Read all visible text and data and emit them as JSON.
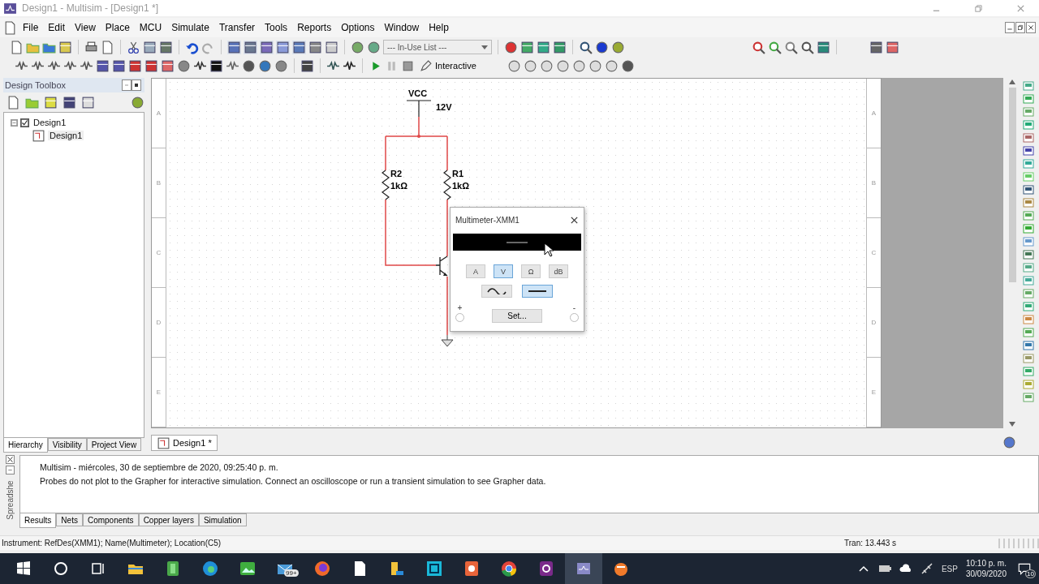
{
  "window": {
    "title": "Design1 - Multisim - [Design1 *]"
  },
  "menu": [
    "File",
    "Edit",
    "View",
    "Place",
    "MCU",
    "Simulate",
    "Transfer",
    "Tools",
    "Reports",
    "Options",
    "Window",
    "Help"
  ],
  "toolbar": {
    "component_list": "--- In-Use List ---",
    "run_mode": "Interactive"
  },
  "design_toolbox": {
    "title": "Design Toolbox",
    "tree": [
      {
        "label": "Design1",
        "checked": true,
        "expanded": true,
        "children": [
          {
            "label": "Design1"
          }
        ]
      }
    ],
    "tabs": [
      {
        "label": "Hierarchy",
        "selected": true
      },
      {
        "label": "Visibility",
        "selected": false
      },
      {
        "label": "Project View",
        "selected": false
      }
    ]
  },
  "schematic": {
    "border_labels_left": [
      "A",
      "B",
      "C",
      "D",
      "E"
    ],
    "border_labels_right": [
      "A",
      "B",
      "C",
      "D",
      "E"
    ],
    "supply": {
      "name": "VCC",
      "value": "12V"
    },
    "resistors": [
      {
        "ref": "R2",
        "value": "1kΩ"
      },
      {
        "ref": "R1",
        "value": "1kΩ"
      }
    ]
  },
  "multimeter": {
    "title": "Multimeter-XMM1",
    "modes": [
      {
        "label": "A",
        "selected": false
      },
      {
        "label": "V",
        "selected": true
      },
      {
        "label": "Ω",
        "selected": false
      },
      {
        "label": "dB",
        "selected": false
      }
    ],
    "signal": [
      {
        "kind": "ac",
        "selected": false
      },
      {
        "kind": "dc",
        "selected": true
      }
    ],
    "plus": "+",
    "minus": "-",
    "set_button": "Set..."
  },
  "document_tabs": [
    {
      "label": "Design1 *",
      "selected": true
    }
  ],
  "spreadsheet": {
    "side_label": "Spreadshe",
    "messages": [
      "Multisim  -  miércoles, 30 de septiembre de 2020, 09:25:40 p. m.",
      "Probes do not plot to the Grapher for interactive simulation. Connect an oscilloscope or run a transient simulation to see Grapher data."
    ],
    "tabs": [
      {
        "label": "Results",
        "selected": true
      },
      {
        "label": "Nets",
        "selected": false
      },
      {
        "label": "Components",
        "selected": false
      },
      {
        "label": "Copper layers",
        "selected": false
      },
      {
        "label": "Simulation",
        "selected": false
      }
    ]
  },
  "status_bar": {
    "message": "Instrument: RefDes(XMM1); Name(Multimeter); Location(C5)",
    "simulation_time": "Tran: 13.443 s"
  },
  "taskbar": {
    "mail_badge": "99+",
    "language": "ESP",
    "time": "10:10 p. m.",
    "date": "30/09/2020",
    "notification_count": "10"
  }
}
